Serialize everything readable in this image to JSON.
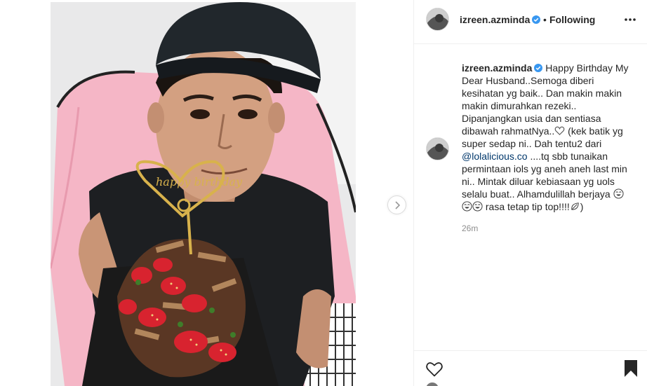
{
  "post": {
    "username": "izreen.azminda",
    "verified": true,
    "separator": "•",
    "follow_status": "Following",
    "more_icon": "more-horizontal-icon",
    "photo_description_icon": "post-photo",
    "cake_topper_text": "happy birthday"
  },
  "caption": {
    "username": "izreen.azminda",
    "text_1": " Happy Birthday My Dear Husband..Semoga diberi kesihatan yg baik.. Dan makin makin makin dimurahkan rezeki.. Dipanjangkan usia dan sentiasa dibawah rahmatNya..",
    "text_2": " (kek batik yg super sedap ni.. Dah tentu2 dari ",
    "mention": "@lolalicious.co",
    "text_3": " ....tq sbb tunaikan permintaan iols yg aneh aneh last min ni.. Mintak diluar kebiasaan yg uols selalu buat.. Alhamdulillah berjaya ",
    "text_4": " rasa tetap tip top!!!!",
    "text_5": ")",
    "timestamp": "26m"
  },
  "colors": {
    "mention": "#00376b",
    "verified": "#3897f0",
    "muted": "#8e8e8e",
    "border": "#efefef"
  }
}
